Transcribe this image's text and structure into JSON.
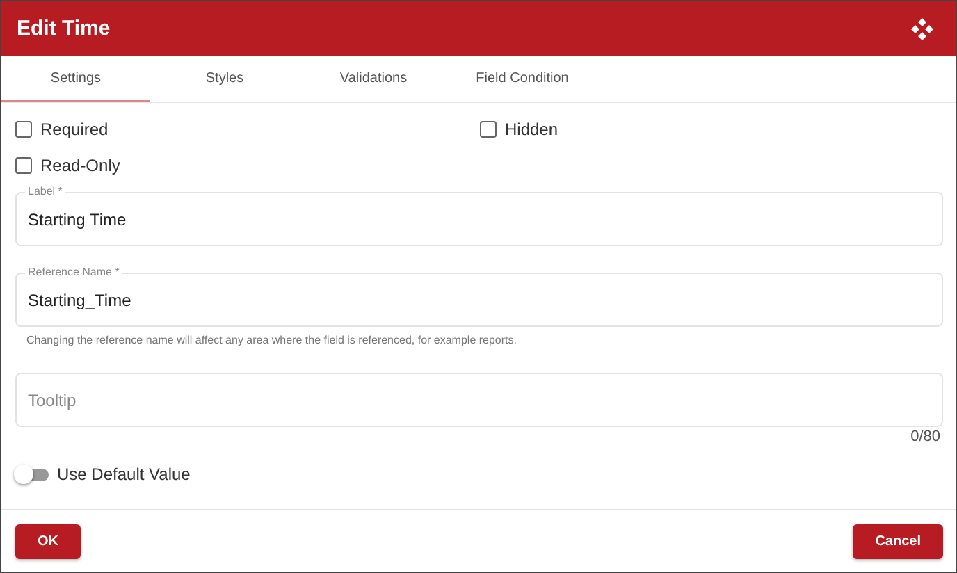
{
  "window": {
    "title": "Edit Time"
  },
  "tabs": [
    {
      "label": "Settings",
      "selected": true
    },
    {
      "label": "Styles",
      "selected": false
    },
    {
      "label": "Validations",
      "selected": false
    },
    {
      "label": "Field Condition",
      "selected": false
    }
  ],
  "checkboxes": [
    {
      "label": "Required",
      "checked": false
    },
    {
      "label": "Hidden",
      "checked": false
    },
    {
      "label": "Read-Only",
      "checked": false
    }
  ],
  "label_field": {
    "label": "Label *",
    "value": "Starting Time"
  },
  "reference_field": {
    "label": "Reference Name *",
    "value": "Starting_Time",
    "help": "Changing the reference name will affect any area where the field is referenced, for example reports."
  },
  "tooltip_field": {
    "placeholder": "Tooltip",
    "counter": "0/80"
  },
  "default_toggle": {
    "label": "Use Default Value",
    "on": false
  },
  "buttons": {
    "ok": "OK",
    "cancel": "Cancel"
  }
}
